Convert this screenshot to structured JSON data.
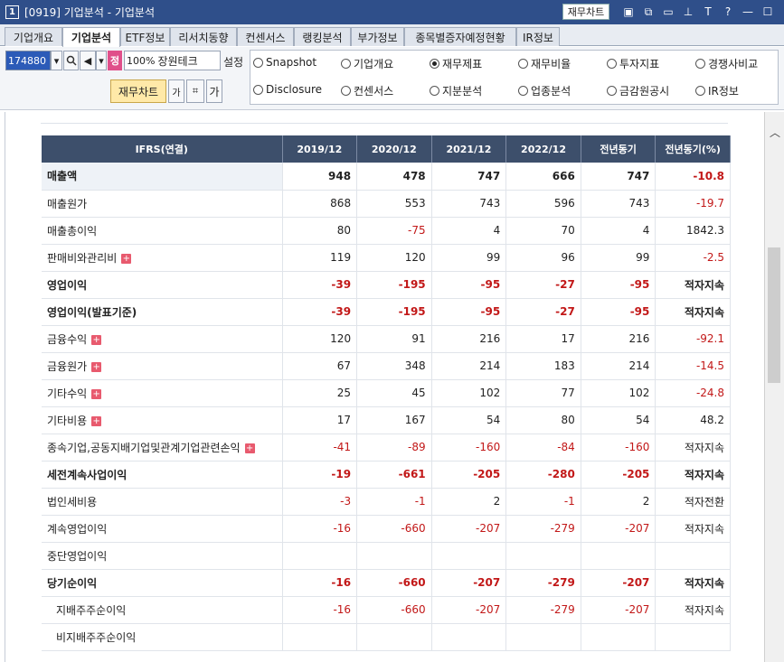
{
  "window": {
    "number_badge": "1",
    "title": "[0919] 기업분석 - 기업분석",
    "finance_chart_label": "재무차트",
    "icons": [
      "chart-icon",
      "restore-icon",
      "window-icon",
      "pin-icon",
      "font-icon",
      "help-icon",
      "minimize-icon",
      "maximize-icon",
      "close-icon"
    ],
    "icon_glyphs": [
      "▣",
      "⧉",
      "▭",
      "⊥",
      "T",
      "?",
      "—",
      "☐",
      "✕"
    ]
  },
  "tabs": [
    {
      "label": "기업개요",
      "active": false
    },
    {
      "label": "기업분석",
      "active": true
    },
    {
      "label": "ETF정보",
      "active": false
    },
    {
      "label": "리서치동향",
      "active": false
    },
    {
      "label": "컨센서스",
      "active": false
    },
    {
      "label": "랭킹분석",
      "active": false
    },
    {
      "label": "부가정보",
      "active": false
    },
    {
      "label": "종목별증자예정현황",
      "active": false
    },
    {
      "label": "IR정보",
      "active": false
    }
  ],
  "controls": {
    "code": "174880",
    "zoom": "100%",
    "company": "장원테크",
    "jung_badge": "정",
    "setting_label": "설정",
    "finance_chart_button": "재무차트",
    "font_icon_label": "가",
    "font_icon_label2": "가"
  },
  "radio_options": [
    {
      "label": "Snapshot",
      "checked": false
    },
    {
      "label": "기업개요",
      "checked": false
    },
    {
      "label": "재무제표",
      "checked": true
    },
    {
      "label": "재무비율",
      "checked": false
    },
    {
      "label": "투자지표",
      "checked": false
    },
    {
      "label": "경쟁사비교",
      "checked": false
    },
    {
      "label": "Disclosure",
      "checked": false
    },
    {
      "label": "컨센서스",
      "checked": false
    },
    {
      "label": "지분분석",
      "checked": false
    },
    {
      "label": "업종분석",
      "checked": false
    },
    {
      "label": "금감원공시",
      "checked": false
    },
    {
      "label": "IR정보",
      "checked": false
    }
  ],
  "table": {
    "headers": [
      "IFRS(연결)",
      "2019/12",
      "2020/12",
      "2021/12",
      "2022/12",
      "전년동기",
      "전년동기(%)"
    ],
    "rows": [
      {
        "label": "매출액",
        "bold": true,
        "plus": false,
        "indent": false,
        "sep": false,
        "values": [
          "948",
          "478",
          "747",
          "666",
          "747",
          "-10.8"
        ]
      },
      {
        "label": "매출원가",
        "bold": false,
        "plus": false,
        "indent": false,
        "sep": false,
        "values": [
          "868",
          "553",
          "743",
          "596",
          "743",
          "-19.7"
        ]
      },
      {
        "label": "매출총이익",
        "bold": false,
        "plus": false,
        "indent": false,
        "sep": false,
        "values": [
          "80",
          "-75",
          "4",
          "70",
          "4",
          "1842.3"
        ]
      },
      {
        "label": "판매비와관리비",
        "bold": false,
        "plus": true,
        "indent": false,
        "sep": true,
        "values": [
          "119",
          "120",
          "99",
          "96",
          "99",
          "-2.5"
        ]
      },
      {
        "label": "영업이익",
        "bold": true,
        "plus": false,
        "indent": false,
        "sep": false,
        "values": [
          "-39",
          "-195",
          "-95",
          "-27",
          "-95",
          "적자지속"
        ]
      },
      {
        "label": "영업이익(발표기준)",
        "bold": true,
        "plus": false,
        "indent": false,
        "sep": false,
        "values": [
          "-39",
          "-195",
          "-95",
          "-27",
          "-95",
          "적자지속"
        ]
      },
      {
        "label": "금융수익",
        "bold": false,
        "plus": true,
        "indent": false,
        "sep": true,
        "values": [
          "120",
          "91",
          "216",
          "17",
          "216",
          "-92.1"
        ]
      },
      {
        "label": "금융원가",
        "bold": false,
        "plus": true,
        "indent": false,
        "sep": false,
        "values": [
          "67",
          "348",
          "214",
          "183",
          "214",
          "-14.5"
        ]
      },
      {
        "label": "기타수익",
        "bold": false,
        "plus": true,
        "indent": false,
        "sep": false,
        "values": [
          "25",
          "45",
          "102",
          "77",
          "102",
          "-24.8"
        ]
      },
      {
        "label": "기타비용",
        "bold": false,
        "plus": true,
        "indent": false,
        "sep": false,
        "values": [
          "17",
          "167",
          "54",
          "80",
          "54",
          "48.2"
        ]
      },
      {
        "label": "종속기업,공동지배기업및관계기업관련손익",
        "bold": false,
        "plus": true,
        "indent": false,
        "sep": false,
        "values": [
          "-41",
          "-89",
          "-160",
          "-84",
          "-160",
          "적자지속"
        ]
      },
      {
        "label": "세전계속사업이익",
        "bold": true,
        "plus": false,
        "indent": false,
        "sep": false,
        "values": [
          "-19",
          "-661",
          "-205",
          "-280",
          "-205",
          "적자지속"
        ]
      },
      {
        "label": "법인세비용",
        "bold": false,
        "plus": false,
        "indent": false,
        "sep": false,
        "values": [
          "-3",
          "-1",
          "2",
          "-1",
          "2",
          "적자전환"
        ]
      },
      {
        "label": "계속영업이익",
        "bold": false,
        "plus": false,
        "indent": false,
        "sep": false,
        "values": [
          "-16",
          "-660",
          "-207",
          "-279",
          "-207",
          "적자지속"
        ]
      },
      {
        "label": "중단영업이익",
        "bold": false,
        "plus": false,
        "indent": false,
        "sep": false,
        "values": [
          "",
          "",
          "",
          "",
          "",
          ""
        ]
      },
      {
        "label": "당기순이익",
        "bold": true,
        "plus": false,
        "indent": false,
        "sep": false,
        "values": [
          "-16",
          "-660",
          "-207",
          "-279",
          "-207",
          "적자지속"
        ]
      },
      {
        "label": "지배주주순이익",
        "bold": false,
        "plus": false,
        "indent": true,
        "sep": false,
        "values": [
          "-16",
          "-660",
          "-207",
          "-279",
          "-207",
          "적자지속"
        ]
      },
      {
        "label": "비지배주주순이익",
        "bold": false,
        "plus": false,
        "indent": true,
        "sep": false,
        "values": [
          "",
          "",
          "",
          "",
          "",
          ""
        ]
      }
    ]
  },
  "colors": {
    "negative": "#c21818",
    "header_bg": "#3d4f6b",
    "title_bg": "#2f4f8a"
  }
}
